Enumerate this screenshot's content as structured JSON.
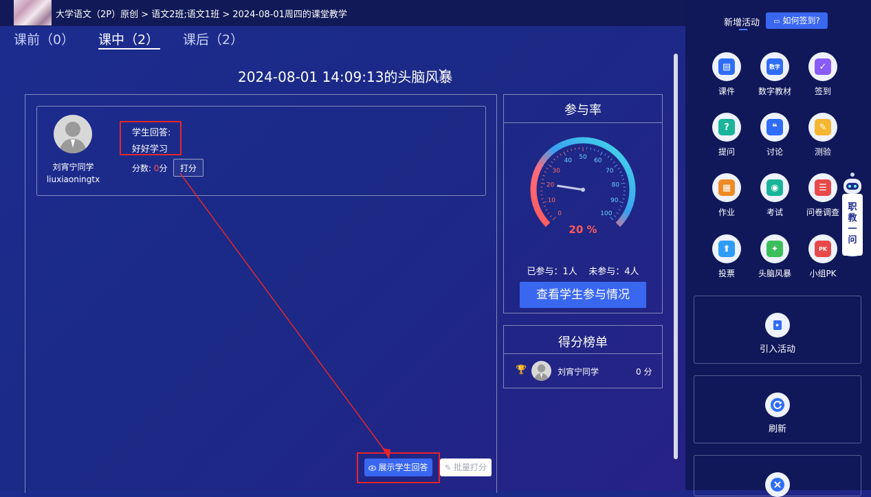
{
  "breadcrumb": {
    "text": "大学语文（2P）原创 > 语文2班;语文1班 > 2024-08-01周四的课堂教学"
  },
  "tabs": [
    {
      "label": "课前（0）"
    },
    {
      "label": "课中（2）"
    },
    {
      "label": "课后（2）"
    }
  ],
  "session": {
    "title": "2024-08-01 14:09:13的头脑风暴"
  },
  "answer": {
    "student_name": "刘宵宁同学",
    "student_id": "liuxiaoningtx",
    "label": "学生回答:",
    "text": "好好学习",
    "score_label": "分数:",
    "score_value": "0",
    "score_unit": "分",
    "grade_button": "打分"
  },
  "actions": {
    "show_answers": "展示学生回答",
    "batch_grade": "批量打分"
  },
  "participation": {
    "title": "参与率",
    "rate": 20,
    "rate_text": "20 %",
    "ticks": [
      "0",
      "10",
      "20",
      "30",
      "40",
      "50",
      "60",
      "70",
      "80",
      "90",
      "100"
    ],
    "stats": "已参与：1人    未参与：4人",
    "view_button": "查看学生参与情况"
  },
  "ranking": {
    "title": "得分榜单",
    "rows": [
      {
        "name": "刘宵宁同学",
        "score": "0 分"
      }
    ]
  },
  "sidebar": {
    "new_activity": "新增活动",
    "howto": "如何签到?",
    "activities": [
      {
        "label": "课件",
        "icon": "courseware-icon",
        "color": "#2f6df6"
      },
      {
        "label": "数字教材",
        "icon": "digital-textbook-icon",
        "color": "#2f6df6"
      },
      {
        "label": "签到",
        "icon": "checkin-icon",
        "color": "#8a5cf6"
      },
      {
        "label": "提问",
        "icon": "question-icon",
        "color": "#19b49a"
      },
      {
        "label": "讨论",
        "icon": "discussion-icon",
        "color": "#2f6df6"
      },
      {
        "label": "测验",
        "icon": "quiz-icon",
        "color": "#f5b731"
      },
      {
        "label": "作业",
        "icon": "homework-icon",
        "color": "#f08a24"
      },
      {
        "label": "考试",
        "icon": "exam-icon",
        "color": "#19b49a"
      },
      {
        "label": "问卷调查",
        "icon": "survey-icon",
        "color": "#e84a4a"
      },
      {
        "label": "投票",
        "icon": "vote-icon",
        "color": "#2f9cf6"
      },
      {
        "label": "头脑风暴",
        "icon": "brainstorm-icon",
        "color": "#3cbf5a"
      },
      {
        "label": "小组PK",
        "icon": "group-pk-icon",
        "color": "#e84a4a"
      }
    ],
    "import_activity": "引入活动",
    "refresh": "刷新",
    "robot_text": "职教一问"
  }
}
